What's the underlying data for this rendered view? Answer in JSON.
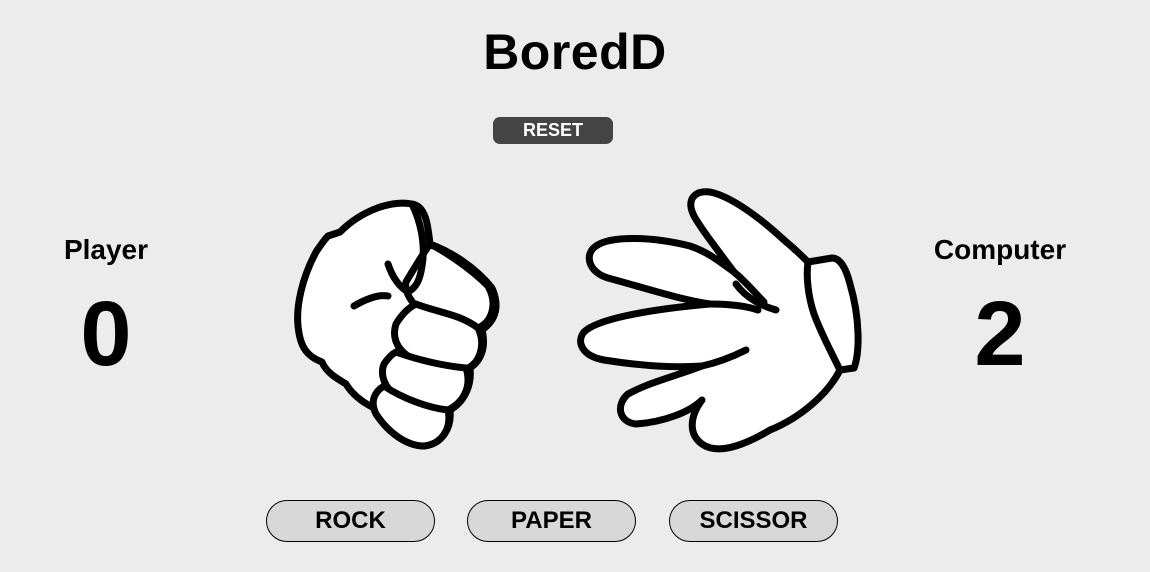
{
  "app": {
    "title": "BoredD"
  },
  "controls": {
    "reset_label": "RESET"
  },
  "scoreboard": {
    "player": {
      "label": "Player",
      "score": "0"
    },
    "computer": {
      "label": "Computer",
      "score": "2"
    }
  },
  "hands": {
    "player": "rock",
    "computer": "paper"
  },
  "choices": [
    {
      "id": "rock",
      "label": "ROCK"
    },
    {
      "id": "paper",
      "label": "PAPER"
    },
    {
      "id": "scissor",
      "label": "SCISSOR"
    }
  ],
  "colors": {
    "background": "#ececec",
    "reset_button": "#444444",
    "choice_button": "#d8d8d8"
  }
}
